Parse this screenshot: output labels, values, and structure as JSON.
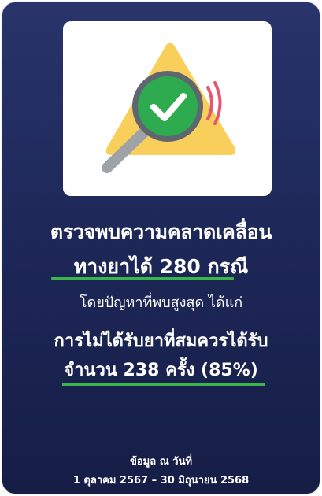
{
  "card": {
    "icon_name": "warning-magnifier-check-icon",
    "headline_line1": "ตรวจพบความคลาดเคลื่อน",
    "headline_line2": "ทางยาได้ 280 กรณี",
    "subtitle": "โดยปัญหาที่พบสูงสุด ได้แก่",
    "highlight_line1": "การไม่ได้รับยาที่สมควรได้รับ",
    "highlight_line2": "จำนวน 238 ครั้ง (85%)",
    "footer_label": "ข้อมูล ณ วันที่",
    "footer_dates": "1 ตุลาคม 2567 – 30 มิถุนายน 2568"
  },
  "colors": {
    "background": "#1e2859",
    "accent_green": "#39b54a",
    "warning_yellow": "#f7cf5a",
    "alert_pink": "#e8566e"
  }
}
